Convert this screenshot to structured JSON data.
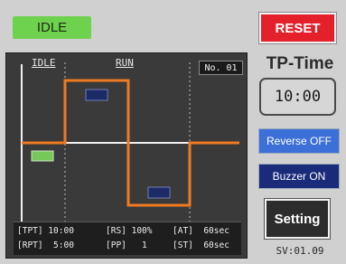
{
  "status": {
    "label": "IDLE",
    "color": "#6ed24e"
  },
  "reset_button": {
    "label": "RESET",
    "color": "#e4202a"
  },
  "chart": {
    "phase_labels": {
      "idle": "IDLE",
      "run": "RUN"
    },
    "program_no": "No. 01",
    "profile_color": "#f07a22",
    "params": {
      "tpt": "[TPT] 10:00",
      "rs": "[RS] 100%",
      "at": "[AT]  60sec",
      "rpt": "[RPT]  5:00",
      "pp": "[PP]   1",
      "st": "[ST]  60sec"
    }
  },
  "tp_time": {
    "label": "TP-Time",
    "value": "10:00"
  },
  "buttons": {
    "reverse": {
      "label": "Reverse OFF",
      "color": "#3d6fd8"
    },
    "buzzer": {
      "label": "Buzzer ON",
      "color": "#1a2b7a"
    },
    "setting": {
      "label": "Setting"
    }
  },
  "version": "SV:01.09"
}
